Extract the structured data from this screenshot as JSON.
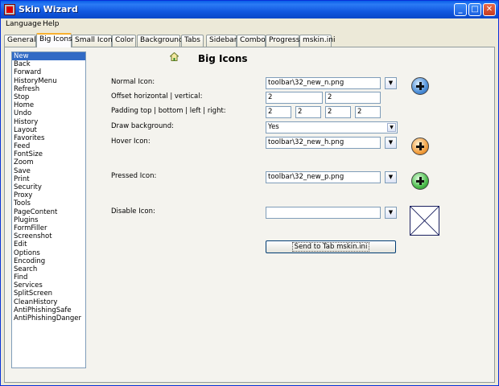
{
  "window": {
    "title": "Skin Wizard"
  },
  "menu": [
    "Language",
    "Help"
  ],
  "tabs": [
    "General",
    "Big Icons",
    "Small Icons",
    "Color",
    "Background",
    "Tabs",
    "Sidebar",
    "Combo",
    "Progress",
    "mskin.ini"
  ],
  "active_tab": "Big Icons",
  "list_items": [
    "New",
    "Back",
    "Forward",
    "HistoryMenu",
    "Refresh",
    "Stop",
    "Home",
    "Undo",
    "History",
    "Layout",
    "Favorites",
    "Feed",
    "FontSize",
    "Zoom",
    "Save",
    "Print",
    "Security",
    "Proxy",
    "Tools",
    "PageContent",
    "Plugins",
    "FormFiller",
    "Screenshot",
    "Edit",
    "Options",
    "Encoding",
    "Search",
    "Find",
    "Services",
    "SplitScreen",
    "CleanHistory",
    "AntiPhishingSafe",
    "AntiPhishingDanger"
  ],
  "selected_item": "New",
  "heading": "Big Icons",
  "labels": {
    "normal_icon": "Normal Icon:",
    "offset": "Offset horizontal | vertical:",
    "padding": "Padding top | bottom | left | right:",
    "draw_background": "Draw background:",
    "hover_icon": "Hover Icon:",
    "pressed_icon": "Pressed Icon:",
    "disable_icon": "Disable Icon:"
  },
  "values": {
    "normal_icon": "toolbar\\32_new_n.png",
    "offset_h": "2",
    "offset_v": "2",
    "padding_top": "2",
    "padding_bottom": "2",
    "padding_left": "2",
    "padding_right": "2",
    "draw_background": "Yes",
    "hover_icon": "toolbar\\32_new_h.png",
    "pressed_icon": "toolbar\\32_new_p.png",
    "disable_icon": ""
  },
  "send_button": "Send to Tab mskin.ini",
  "icons": {
    "normal": "blue-plus-orb-icon",
    "hover": "orange-plus-orb-icon",
    "pressed": "green-plus-orb-icon",
    "disabled": "empty-image-placeholder-icon"
  },
  "colors": {
    "selection": "#316ac5",
    "titlebar": "#0a5ee8",
    "active_tab_accent": "#f7b02f"
  }
}
